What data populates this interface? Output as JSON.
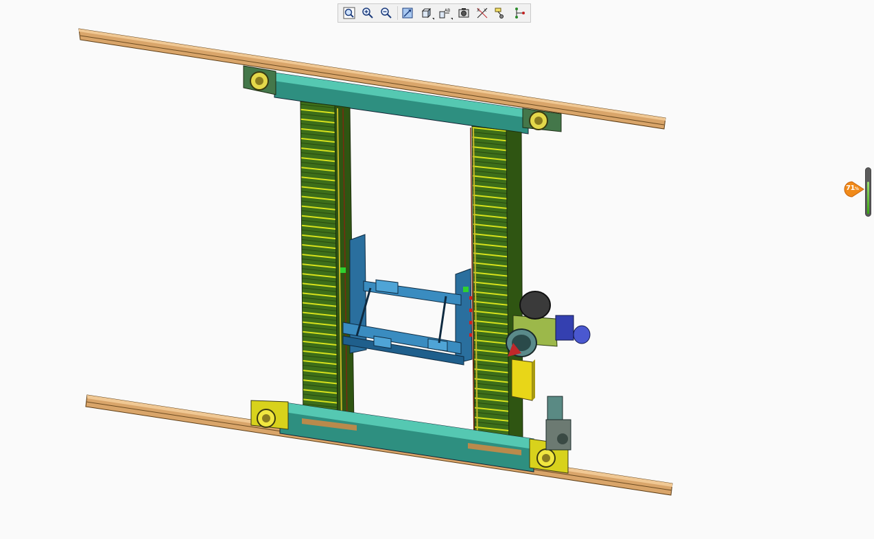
{
  "toolbar": {
    "buttons": [
      {
        "name": "fit-all-icon"
      },
      {
        "name": "zoom-in-icon"
      },
      {
        "name": "zoom-out-icon"
      },
      {
        "name": "normal-view-icon"
      },
      {
        "name": "iso-view-icon"
      },
      {
        "name": "annotation-view-icon"
      },
      {
        "name": "capture-icon"
      },
      {
        "name": "measure-icon"
      },
      {
        "name": "pin-annotation-icon"
      },
      {
        "name": "tree-icon"
      }
    ]
  },
  "zoom": {
    "value": "71",
    "unit": "%",
    "level": 0.71
  },
  "colors": {
    "rail": "#e2b27a",
    "beam": "#3bb5a0",
    "column": "#3a6b18",
    "column_stripe": "#e6e61a",
    "carriage": "#2f7fb2",
    "motor_gray": "#7b8b80",
    "motor_blue": "#3a46b8",
    "junction_box": "#e6d21c",
    "wheel_yellow": "#e8e21a"
  }
}
